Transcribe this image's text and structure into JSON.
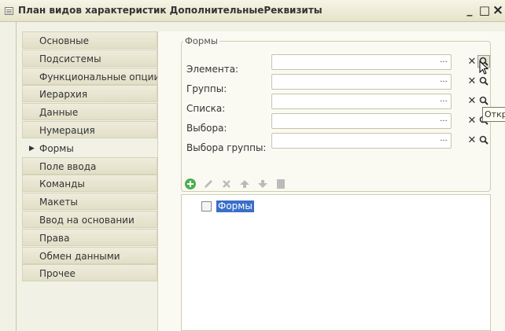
{
  "window": {
    "title": "План видов характеристик ДополнительныеРеквизиты",
    "minimize": "_",
    "maximize": "□",
    "close": "×"
  },
  "nav": {
    "items": [
      {
        "label": "Основные",
        "active": false
      },
      {
        "label": "Подсистемы",
        "active": false
      },
      {
        "label": "Функциональные опции",
        "active": false
      },
      {
        "label": "Иерархия",
        "active": false
      },
      {
        "label": "Данные",
        "active": false
      },
      {
        "label": "Нумерация",
        "active": false
      },
      {
        "label": "Формы",
        "active": true
      },
      {
        "label": "Поле ввода",
        "active": false
      },
      {
        "label": "Команды",
        "active": false
      },
      {
        "label": "Макеты",
        "active": false
      },
      {
        "label": "Ввод на основании",
        "active": false
      },
      {
        "label": "Права",
        "active": false
      },
      {
        "label": "Обмен данными",
        "active": false
      },
      {
        "label": "Прочее",
        "active": false
      }
    ]
  },
  "forms_group": {
    "title": "Формы",
    "fields": [
      {
        "label": "Элемента:",
        "value": ""
      },
      {
        "label": "Группы:",
        "value": ""
      },
      {
        "label": "Списка:",
        "value": ""
      },
      {
        "label": "Выбора:",
        "value": ""
      },
      {
        "label": "Выбора группы:",
        "value": ""
      }
    ],
    "select_button": "...",
    "clear_icon": "clear-icon",
    "open_icon": "open-icon"
  },
  "toolbar": {
    "icons": [
      "add-icon",
      "edit-icon",
      "delete-icon",
      "move-up-icon",
      "move-down-icon",
      "properties-icon"
    ]
  },
  "tree": {
    "items": [
      {
        "label": "Формы",
        "selected": true
      }
    ]
  },
  "tooltip": {
    "text": "Откр"
  },
  "colors": {
    "selection": "#3a6ec9",
    "add_green": "#4caf50"
  }
}
